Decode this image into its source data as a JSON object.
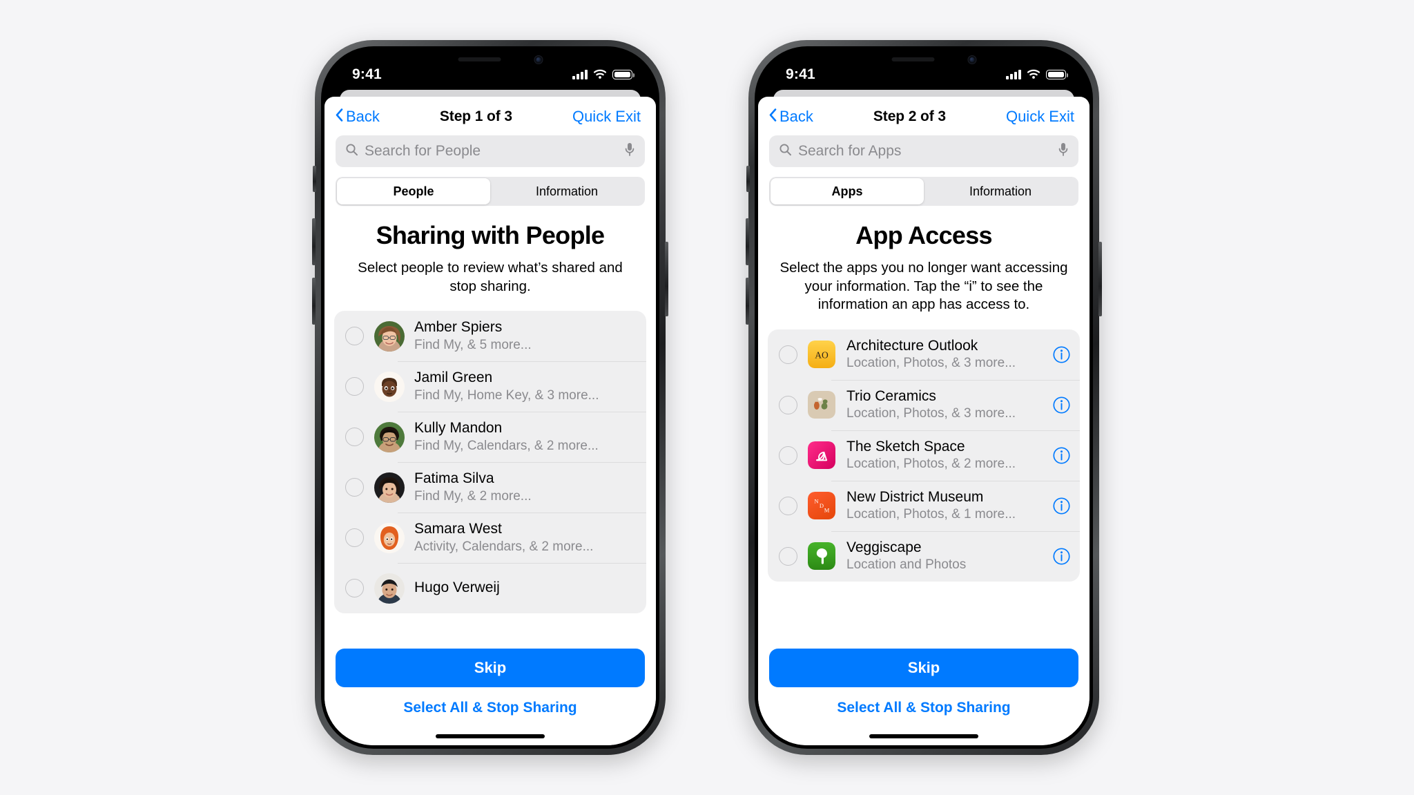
{
  "meta": {
    "background_color": "#f5f5f7",
    "accent_color": "#007aff"
  },
  "status_bar": {
    "time": "9:41",
    "cellular_icon": "signal-bars-icon",
    "wifi_icon": "wifi-icon",
    "battery_icon": "battery-full-icon"
  },
  "phones": [
    {
      "id": "phone-left",
      "nav": {
        "back_icon": "chevron-left-icon",
        "back_label": "Back",
        "title": "Step 1 of 3",
        "quick_exit_label": "Quick Exit"
      },
      "search": {
        "icon": "search-icon",
        "placeholder": "Search for People",
        "mic_icon": "microphone-icon",
        "value": ""
      },
      "segmented": {
        "options": [
          "People",
          "Information"
        ],
        "selected": "People"
      },
      "headline": "Sharing with People",
      "subhead": "Select people to review what’s shared and stop sharing.",
      "list_type": "people",
      "rows": [
        {
          "title": "Amber Spiers",
          "subtitle": "Find My, & 5 more...",
          "avatar": "photo-woman-glasses",
          "selected": false
        },
        {
          "title": "Jamil Green",
          "subtitle": "Find My, Home Key, & 3 more...",
          "avatar": "memoji-man",
          "selected": false
        },
        {
          "title": "Kully Mandon",
          "subtitle": "Find My, Calendars, & 2 more...",
          "avatar": "photo-man-glasses",
          "selected": false
        },
        {
          "title": "Fatima Silva",
          "subtitle": "Find My, & 2 more...",
          "avatar": "photo-woman-dark",
          "selected": false
        },
        {
          "title": "Samara West",
          "subtitle": "Activity, Calendars, & 2 more...",
          "avatar": "memoji-woman-hijab",
          "selected": false
        },
        {
          "title": "Hugo Verweij",
          "subtitle": "",
          "avatar": "photo-man",
          "selected": false
        }
      ],
      "footer": {
        "primary_label": "Skip",
        "secondary_label": "Select All & Stop Sharing"
      }
    },
    {
      "id": "phone-right",
      "nav": {
        "back_icon": "chevron-left-icon",
        "back_label": "Back",
        "title": "Step 2 of 3",
        "quick_exit_label": "Quick Exit"
      },
      "search": {
        "icon": "search-icon",
        "placeholder": "Search for Apps",
        "mic_icon": "microphone-icon",
        "value": ""
      },
      "segmented": {
        "options": [
          "Apps",
          "Information"
        ],
        "selected": "Apps"
      },
      "headline": "App Access",
      "subhead": "Select the apps you no longer want accessing your information. Tap the “i” to see the information an app has access to.",
      "list_type": "apps",
      "rows": [
        {
          "title": "Architecture Outlook",
          "subtitle": "Location, Photos, & 3 more...",
          "icon": "app-icon-architecture-outlook",
          "icon_color": "#fcc02e",
          "selected": false,
          "info_icon": "info-circle-icon"
        },
        {
          "title": "Trio Ceramics",
          "subtitle": "Location, Photos, & 3 more...",
          "icon": "app-icon-trio-ceramics",
          "icon_color": "#d7c8b2",
          "selected": false,
          "info_icon": "info-circle-icon"
        },
        {
          "title": "The Sketch Space",
          "subtitle": "Location, Photos, & 2 more...",
          "icon": "app-icon-the-sketch-space",
          "icon_color": "#f2046e",
          "selected": false,
          "info_icon": "info-circle-icon"
        },
        {
          "title": "New District Museum",
          "subtitle": "Location, Photos, & 1 more...",
          "icon": "app-icon-new-district-museum",
          "icon_color": "#f04a23",
          "selected": false,
          "info_icon": "info-circle-icon"
        },
        {
          "title": "Veggiscape",
          "subtitle": "Location and Photos",
          "icon": "app-icon-veggiscape",
          "icon_color": "#36a022",
          "selected": false,
          "info_icon": "info-circle-icon"
        }
      ],
      "footer": {
        "primary_label": "Skip",
        "secondary_label": "Select All & Stop Sharing"
      }
    }
  ]
}
